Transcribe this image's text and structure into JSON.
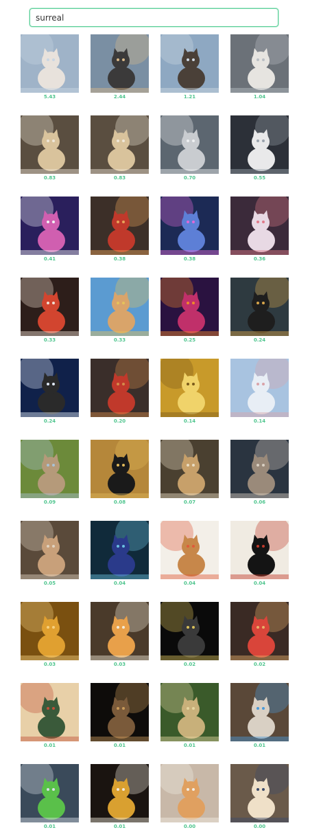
{
  "search": {
    "value": "surreal"
  },
  "results": [
    {
      "score": "5.43",
      "icon": "winged-cat-clouds-image",
      "bg": "#9fb3c8",
      "fg": "#e8e2dc",
      "accent": "#c9d6e3"
    },
    {
      "score": "2.44",
      "icon": "cats-city-rooftop-image",
      "bg": "#7a8fa3",
      "fg": "#3b3a3a",
      "accent": "#d9b98a"
    },
    {
      "score": "1.21",
      "icon": "cat-rooftop-sky-image",
      "bg": "#8ea8c2",
      "fg": "#4a4038",
      "accent": "#cfd9e3"
    },
    {
      "score": "1.04",
      "icon": "winged-cat-grey-image",
      "bg": "#6b7178",
      "fg": "#e6e4e0",
      "accent": "#b9bec4"
    },
    {
      "score": "0.83",
      "icon": "winged-tabby-cat-image",
      "bg": "#5a4e40",
      "fg": "#d9c39c",
      "accent": "#efe7d8"
    },
    {
      "score": "0.83",
      "icon": "winged-tabby-cat-image",
      "bg": "#5a4e40",
      "fg": "#d9c39c",
      "accent": "#efe7d8"
    },
    {
      "score": "0.70",
      "icon": "winged-grey-cat-image",
      "bg": "#5c6670",
      "fg": "#c9ccd0",
      "accent": "#eef0f2"
    },
    {
      "score": "0.55",
      "icon": "fluffy-cat-bathtub-image",
      "bg": "#2c3038",
      "fg": "#e9e9ea",
      "accent": "#9aa3ad"
    },
    {
      "score": "0.41",
      "icon": "neon-city-figure-image",
      "bg": "#2a1f5c",
      "fg": "#d05fb0",
      "accent": "#f2f2f5"
    },
    {
      "score": "0.38",
      "icon": "fish-shop-cat-image",
      "bg": "#3c2f28",
      "fg": "#c0392b",
      "accent": "#e8a35a"
    },
    {
      "score": "0.38",
      "icon": "cosmic-cat-image",
      "bg": "#1c2a55",
      "fg": "#5d7fd6",
      "accent": "#e06ad8"
    },
    {
      "score": "0.36",
      "icon": "cat-lantern-image",
      "bg": "#3b2a3a",
      "fg": "#e8d9e4",
      "accent": "#e07a8a"
    },
    {
      "score": "0.33",
      "icon": "strawberry-cat-image",
      "bg": "#2d1e1a",
      "fg": "#d2452f",
      "accent": "#f0e0d2"
    },
    {
      "score": "0.33",
      "icon": "cat-playground-image",
      "bg": "#5b9bd1",
      "fg": "#d9a46a",
      "accent": "#e6c35a"
    },
    {
      "score": "0.25",
      "icon": "neon-pattern-cat-image",
      "bg": "#2a1240",
      "fg": "#c0306a",
      "accent": "#f08a2a"
    },
    {
      "score": "0.24",
      "icon": "cat-window-night-image",
      "bg": "#2e3a40",
      "fg": "#1e1e1e",
      "accent": "#d7a54a"
    },
    {
      "score": "0.24",
      "icon": "cat-space-water-image",
      "bg": "#10214a",
      "fg": "#2a2a2a",
      "accent": "#dfe8f5"
    },
    {
      "score": "0.20",
      "icon": "fish-shop-cat-image",
      "bg": "#3a2e2a",
      "fg": "#c0392b",
      "accent": "#d48a4a"
    },
    {
      "score": "0.14",
      "icon": "golden-cat-face-image",
      "bg": "#c89a2a",
      "fg": "#f0d36a",
      "accent": "#7a5a1a"
    },
    {
      "score": "0.14",
      "icon": "cat-palace-image",
      "bg": "#a8c3e0",
      "fg": "#e8eef5",
      "accent": "#d9a3a8"
    },
    {
      "score": "0.09",
      "icon": "cat-girl-field-image",
      "bg": "#6c8a3a",
      "fg": "#b59a7a",
      "accent": "#a9c2d6"
    },
    {
      "score": "0.08",
      "icon": "black-cats-art-image",
      "bg": "#b5873a",
      "fg": "#1a1a1a",
      "accent": "#e0b85a"
    },
    {
      "score": "0.07",
      "icon": "cats-tea-table-image",
      "bg": "#4a4030",
      "fg": "#c7a06a",
      "accent": "#e9dcc3"
    },
    {
      "score": "0.06",
      "icon": "tabby-cat-portrait-image",
      "bg": "#2a3440",
      "fg": "#9a8a7a",
      "accent": "#d9cfc2"
    },
    {
      "score": "0.05",
      "icon": "hand-cats-image",
      "bg": "#5a4a3a",
      "fg": "#c8a07a",
      "accent": "#e0d2c0"
    },
    {
      "score": "0.04",
      "icon": "witch-cat-image",
      "bg": "#102a3a",
      "fg": "#2a3a8a",
      "accent": "#6ac0e0"
    },
    {
      "score": "0.04",
      "icon": "cat-paint-splash-image",
      "bg": "#f3efe8",
      "fg": "#c7874a",
      "accent": "#e05a3a"
    },
    {
      "score": "0.04",
      "icon": "ink-creature-image",
      "bg": "#f0ebe2",
      "fg": "#141414",
      "accent": "#c0392b"
    },
    {
      "score": "0.03",
      "icon": "orange-kitten-image",
      "bg": "#7a5010",
      "fg": "#e0a030",
      "accent": "#f5d080"
    },
    {
      "score": "0.03",
      "icon": "cat-sign-flux-image",
      "bg": "#4a3a2a",
      "fg": "#e8a04a",
      "accent": "#f2ead8"
    },
    {
      "score": "0.02",
      "icon": "dark-cat-face-image",
      "bg": "#0a0a0a",
      "fg": "#3a3a3a",
      "accent": "#d9c05a"
    },
    {
      "score": "0.02",
      "icon": "fish-buzz-sign-cat-image",
      "bg": "#3a2a24",
      "fg": "#d9453a",
      "accent": "#e8b06a"
    },
    {
      "score": "0.01",
      "icon": "cartoon-room-image",
      "bg": "#e8d0a8",
      "fg": "#3a5a3a",
      "accent": "#c0503a"
    },
    {
      "score": "0.01",
      "icon": "cat-shadow-light-image",
      "bg": "#0e0c0a",
      "fg": "#7a5a3a",
      "accent": "#c99a5a"
    },
    {
      "score": "0.01",
      "icon": "cat-garden-path-image",
      "bg": "#3a5a2a",
      "fg": "#c8b07a",
      "accent": "#e6d6a0"
    },
    {
      "score": "0.01",
      "icon": "cat-phone-couch-image",
      "bg": "#5a4838",
      "fg": "#d9d0c4",
      "accent": "#4a9ad9"
    },
    {
      "score": "0.01",
      "icon": "garbage-truck-city-image",
      "bg": "#3a4a5a",
      "fg": "#5ac04a",
      "accent": "#d9e0e8"
    },
    {
      "score": "0.01",
      "icon": "cat-yellow-sweater-image",
      "bg": "#1a1410",
      "fg": "#d9a030",
      "accent": "#f0e8dc"
    },
    {
      "score": "0.00",
      "icon": "kitten-sign-image",
      "bg": "#c8b8a8",
      "fg": "#e0a060",
      "accent": "#f2ede4"
    },
    {
      "score": "0.00",
      "icon": "cat-crowd-image",
      "bg": "#6a5a4a",
      "fg": "#efe0c8",
      "accent": "#3a4a6a"
    }
  ]
}
